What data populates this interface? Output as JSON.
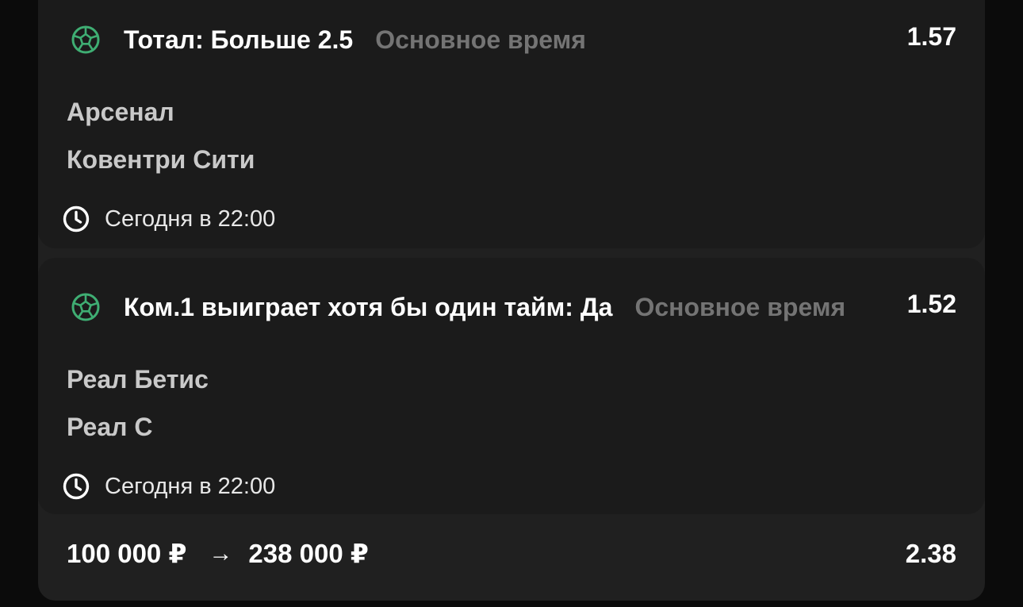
{
  "bets": [
    {
      "market": "Тотал: Больше 2.5",
      "period": "Основное время",
      "odd": "1.57",
      "team1": "Арсенал",
      "team2": "Ковентри Сити",
      "time": "Сегодня в 22:00"
    },
    {
      "market": "Ком.1 выиграет хотя бы один тайм: Да",
      "period": "Основное время",
      "odd": "1.52",
      "team1": "Реал Бетис",
      "team2": "Реал С",
      "time": "Сегодня в 22:00"
    }
  ],
  "summary": {
    "stake": "100 000 ₽",
    "arrow": "→",
    "payout": "238 000 ₽",
    "total_odd": "2.38"
  },
  "icons": {
    "sport": "soccer-ball-icon",
    "time": "clock-icon",
    "arrow": "arrow-right-icon"
  },
  "colors": {
    "accent_green": "#3fae73"
  }
}
